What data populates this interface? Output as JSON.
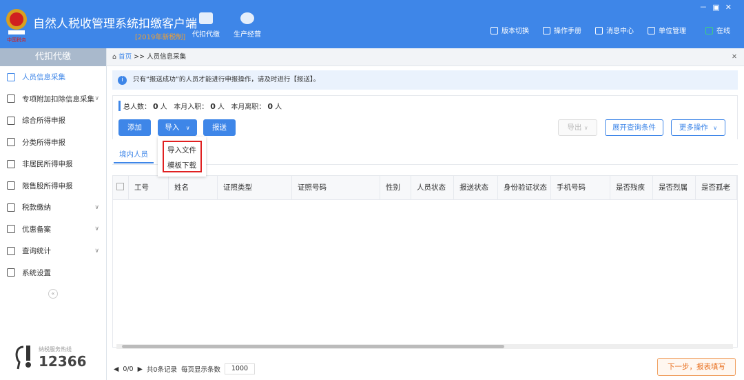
{
  "app": {
    "title": "自然人税收管理系统扣缴客户端",
    "version": "[2019年新税制]",
    "logo_text": "中国税务",
    "modules": [
      {
        "label": "代扣代缴",
        "icon": "wallet-icon"
      },
      {
        "label": "生产经营",
        "icon": "coins-icon"
      }
    ],
    "links": [
      {
        "label": "版本切换",
        "icon": "document-icon"
      },
      {
        "label": "操作手册",
        "icon": "manual-icon"
      },
      {
        "label": "消息中心",
        "icon": "message-icon"
      },
      {
        "label": "单位管理",
        "icon": "building-icon"
      },
      {
        "label": "在线",
        "icon": "online-monitor-icon"
      }
    ],
    "window_controls": [
      "－",
      "▣",
      "✕"
    ],
    "accent": "#3e86e8"
  },
  "sidebar": {
    "header": "代扣代缴",
    "items": [
      {
        "label": "人员信息采集",
        "active": true
      },
      {
        "label": "专项附加扣除信息采集",
        "chev": true
      },
      {
        "label": "综合所得申报"
      },
      {
        "label": "分类所得申报"
      },
      {
        "label": "非居民所得申报"
      },
      {
        "label": "限售股所得申报"
      },
      {
        "label": "税款缴纳",
        "chev": true
      },
      {
        "label": "优惠备案",
        "chev": true
      },
      {
        "label": "查询统计",
        "chev": true
      },
      {
        "label": "系统设置"
      }
    ],
    "collapse": "«",
    "hotline_label": "纳税服务热线",
    "hotline": "12366"
  },
  "breadcrumb": {
    "home": "首页",
    "sep": ">>",
    "current": "人员信息采集",
    "close": "✕"
  },
  "notice": "只有“报送成功”的人员才能进行申报操作，请及时进行【报送】。",
  "stats": {
    "total_label": "总人数：",
    "total": "0",
    "unit": "人",
    "joined_label": "本月入职：",
    "joined": "0",
    "left_label": "本月离职：",
    "left": "0"
  },
  "buttons": {
    "add": "添加",
    "import": "导入",
    "submit": "报送",
    "export": "导出",
    "expand_query": "展开查询条件",
    "more": "更多操作"
  },
  "import_menu": [
    "导入文件",
    "模板下载"
  ],
  "tabs": [
    "境内人员"
  ],
  "table": {
    "columns": [
      "工号",
      "姓名",
      "证照类型",
      "证照号码",
      "性别",
      "人员状态",
      "报送状态",
      "身份验证状态",
      "手机号码",
      "是否残疾",
      "是否烈属",
      "是否孤老"
    ],
    "rows": []
  },
  "pager": {
    "pages": "0/0",
    "records": "共0条记录",
    "per_page_label": "每页显示条数",
    "per_page": "1000"
  },
  "next_button": "下一步，报表填写"
}
